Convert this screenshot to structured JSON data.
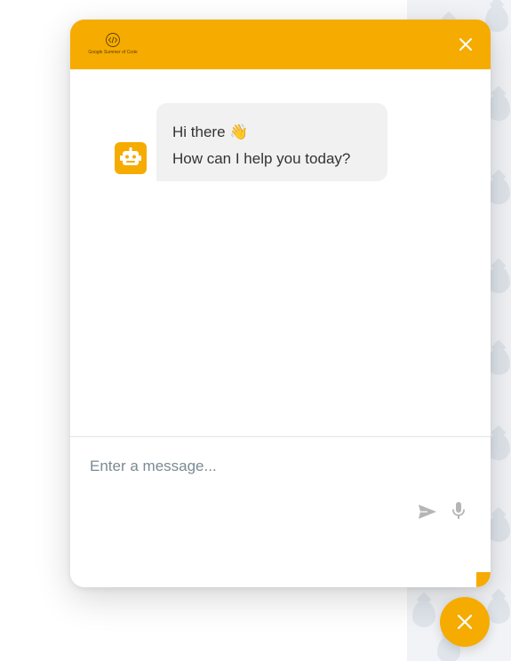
{
  "header": {
    "logo_text": "Google Summer of Code",
    "close_icon": "close-icon"
  },
  "messages": [
    {
      "sender": "bot",
      "avatar_icon": "robot-icon",
      "lines": [
        "Hi there 👋",
        "How can I help you today?"
      ]
    }
  ],
  "composer": {
    "placeholder": "Enter a message...",
    "send_icon": "send-icon",
    "mic_icon": "microphone-icon"
  },
  "launcher": {
    "icon": "close-icon"
  },
  "colors": {
    "accent": "#f6ab00",
    "bubble_bg": "#f1f1f1",
    "placeholder": "#7b8a93",
    "icon_gray": "#b5b5b5"
  }
}
